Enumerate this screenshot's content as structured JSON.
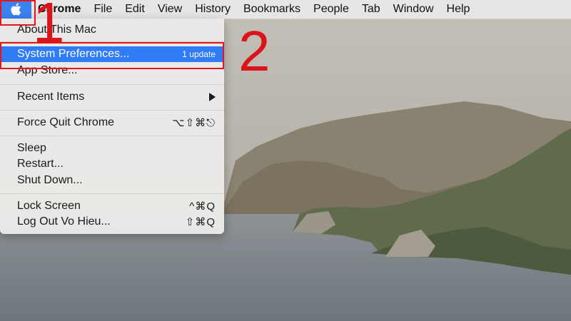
{
  "menubar": {
    "app_name": "Chrome",
    "items": [
      "File",
      "Edit",
      "View",
      "History",
      "Bookmarks",
      "People",
      "Tab",
      "Window",
      "Help"
    ]
  },
  "apple_menu": {
    "about": "About This Mac",
    "system_preferences": "System Preferences...",
    "system_preferences_badge": "1 update",
    "app_store": "App Store...",
    "recent_items": "Recent Items",
    "force_quit": "Force Quit Chrome",
    "force_quit_shortcut": "⌥⇧⌘⎋",
    "sleep": "Sleep",
    "restart": "Restart...",
    "shut_down": "Shut Down...",
    "lock_screen": "Lock Screen",
    "lock_screen_shortcut": "^⌘Q",
    "log_out": "Log Out Vo Hieu...",
    "log_out_shortcut": "⇧⌘Q"
  },
  "annotations": {
    "step1": "1",
    "step2": "2"
  },
  "colors": {
    "highlight": "#2f7cf6",
    "annotation": "#e3161b"
  }
}
